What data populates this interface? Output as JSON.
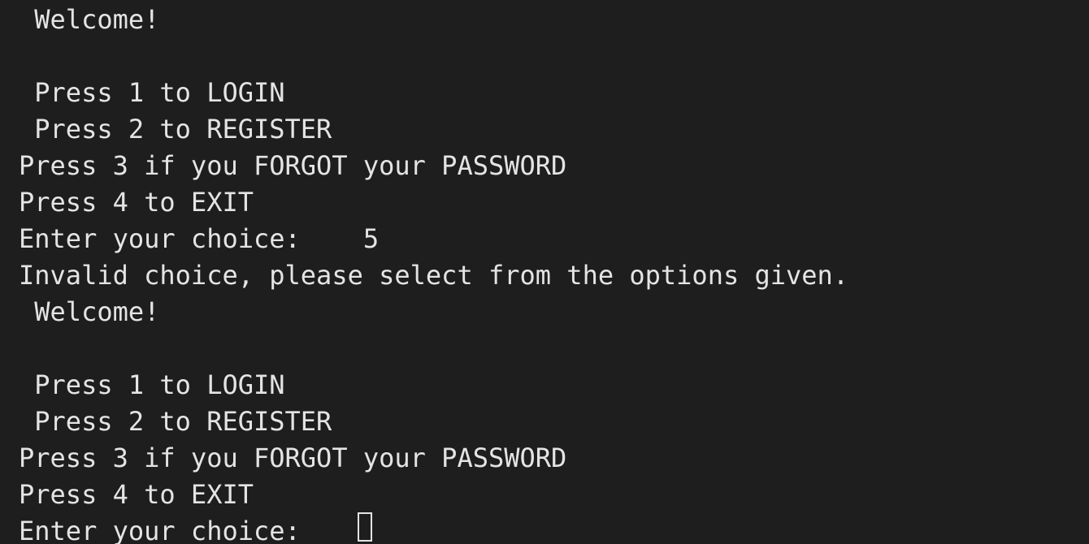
{
  "terminal": {
    "lines": [
      " Welcome!",
      "",
      " Press 1 to LOGIN",
      " Press 2 to REGISTER",
      "Press 3 if you FORGOT your PASSWORD",
      "Press 4 to EXIT",
      "Enter your choice:    5",
      "Invalid choice, please select from the options given.",
      " Welcome!",
      "",
      " Press 1 to LOGIN",
      " Press 2 to REGISTER",
      "Press 3 if you FORGOT your PASSWORD",
      "Press 4 to EXIT",
      "Enter your choice:    "
    ]
  },
  "colors": {
    "background": "#1e1e1e",
    "text": "#e4e4e4"
  }
}
